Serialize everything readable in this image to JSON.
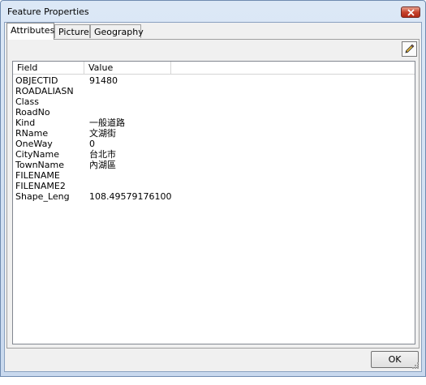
{
  "window": {
    "title": "Feature Properties"
  },
  "tabs": [
    {
      "label": "Attributes",
      "active": true
    },
    {
      "label": "Picture",
      "active": false
    },
    {
      "label": "Geography",
      "active": false
    }
  ],
  "toolbar": {
    "edit_icon": "pencil-icon"
  },
  "table": {
    "columns": [
      "Field",
      "Value"
    ],
    "rows": [
      {
        "field": "OBJECTID",
        "value": "91480"
      },
      {
        "field": "ROADALIASN",
        "value": ""
      },
      {
        "field": "Class",
        "value": ""
      },
      {
        "field": "RoadNo",
        "value": ""
      },
      {
        "field": "Kind",
        "value": "一般道路"
      },
      {
        "field": "RName",
        "value": "文湖街"
      },
      {
        "field": "OneWay",
        "value": "0"
      },
      {
        "field": "CityName",
        "value": "台北市"
      },
      {
        "field": "TownName",
        "value": "內湖區"
      },
      {
        "field": "FILENAME",
        "value": ""
      },
      {
        "field": "FILENAME2",
        "value": ""
      },
      {
        "field": "Shape_Leng",
        "value": "108.49579176100"
      }
    ]
  },
  "buttons": {
    "ok_label": "OK"
  }
}
